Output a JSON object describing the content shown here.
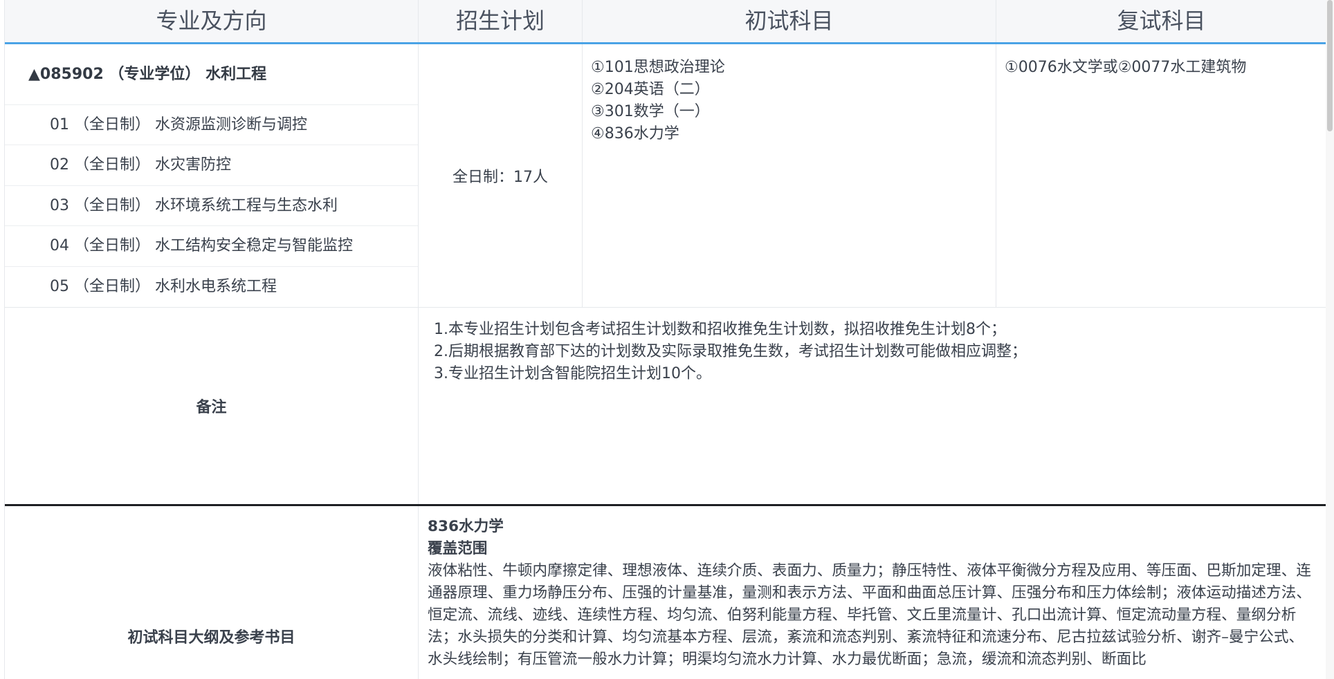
{
  "header": {
    "col_major": "专业及方向",
    "col_plan": "招生计划",
    "col_exam": "初试科目",
    "col_retest": "复试科目"
  },
  "program": {
    "title": "▲085902 （专业学位） 水利工程",
    "directions": [
      "01 （全日制） 水资源监测诊断与调控",
      "02 （全日制） 水灾害防控",
      "03 （全日制） 水环境系统工程与生态水利",
      "04 （全日制） 水工结构安全稳定与智能监控",
      "05 （全日制） 水利水电系统工程"
    ],
    "plan": "全日制：17人",
    "exam_subjects": [
      "①101思想政治理论",
      "②204英语（二）",
      "③301数学（一）",
      "④836水力学"
    ],
    "retest": "①0076水文学或②0077水工建筑物"
  },
  "notes": {
    "label": "备注",
    "lines": [
      "1.本专业招生计划包含考试招生计划数和招收推免生计划数，拟招收推免生计划8个；",
      "2.后期根据教育部下达的计划数及实际录取推免生数，考试招生计划数可能做相应调整；",
      "3.专业招生计划含智能院招生计划10个。"
    ]
  },
  "syllabus": {
    "label": "初试科目大纲及参考书目",
    "subject": "836水力学",
    "section": "覆盖范围",
    "text": "液体粘性、牛顿内摩擦定律、理想液体、连续介质、表面力、质量力；静压特性、液体平衡微分方程及应用、等压面、巴斯加定理、连通器原理、重力场静压分布、压强的计量基准，量测和表示方法、平面和曲面总压计算、压强分布和压力体绘制；液体运动描述方法、恒定流、流线、迹线、连续性方程、均匀流、伯努利能量方程、毕托管、文丘里流量计、孔口出流计算、恒定流动量方程、量纲分析法；水头损失的分类和计算、均匀流基本方程、层流，紊流和流态判别、紊流特征和流速分布、尼古拉兹试验分析、谢齐–曼宁公式、水头线绘制；有压管流一般水力计算；明渠均匀流水力计算、水力最优断面；急流，缓流和流态判别、断面比"
  }
}
